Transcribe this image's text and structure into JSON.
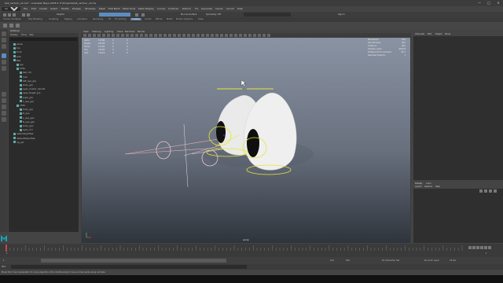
{
  "window": {
    "title": "ball_cartoon_v2.ma* - Autodesk Maya 2018.4: E:\\Projects\\ball_cartoon_v2.ma",
    "controls": [
      "—",
      "□",
      "✕"
    ]
  },
  "menubar": {
    "items": [
      "File",
      "Edit",
      "Create",
      "Select",
      "Modify",
      "Display",
      "Windows",
      "Mesh",
      "Edit Mesh",
      "Mesh Tools",
      "Mesh Display",
      "Curves",
      "Surfaces",
      "Deform",
      "UV",
      "Generate",
      "Cache",
      "Arnold",
      "Help"
    ]
  },
  "statusline": {
    "mode": "Animation",
    "objects_label": "Objects",
    "no_live_surface": "No Live Surface",
    "symmetry": "Symmetry: Off",
    "sign_in": "Sign In"
  },
  "shelf": {
    "tabs": [
      "Curves / Surfaces",
      "Poly Modeling",
      "Sculpting",
      "Rigging",
      "Animation",
      "Rendering",
      "FX",
      "FX Caching",
      "Custom",
      "Arnold",
      "Bifrost",
      "MASH",
      "Motion Graphics",
      "XGen"
    ],
    "active_index": 8
  },
  "outliner": {
    "title": "Outliner",
    "menu": [
      "Display",
      "Show",
      "Help"
    ],
    "items": [
      {
        "label": "persp",
        "depth": 1
      },
      {
        "label": "top",
        "depth": 1
      },
      {
        "label": "front",
        "depth": 1
      },
      {
        "label": "side",
        "depth": 1
      },
      {
        "label": "Ball",
        "depth": 1
      },
      {
        "label": "grp",
        "depth": 2
      },
      {
        "label": "CTRL",
        "depth": 2
      },
      {
        "label": "ball_ctrl",
        "depth": 3
      },
      {
        "label": "root",
        "depth": 3
      },
      {
        "label": "left_eye_grp",
        "depth": 3
      },
      {
        "label": "body_grp",
        "depth": 3
      },
      {
        "label": "eyes_cluster_handle",
        "depth": 3
      },
      {
        "label": "eyes_target_grp",
        "depth": 3
      },
      {
        "label": "pupil_grp",
        "depth": 3
      },
      {
        "label": "L_eye_grp",
        "depth": 3
      },
      {
        "label": "CTRL",
        "depth": 2
      },
      {
        "label": "body_grp",
        "depth": 3
      },
      {
        "label": "R_eye",
        "depth": 3
      },
      {
        "label": "L_eye_geo",
        "depth": 3
      },
      {
        "label": "R_eye_geo",
        "depth": 3
      },
      {
        "label": "body_geo",
        "depth": 3
      },
      {
        "label": "eyes_ctrl",
        "depth": 3
      },
      {
        "label": "defaultLightSet",
        "depth": 1
      },
      {
        "label": "defaultObjectSet",
        "depth": 1
      },
      {
        "label": "rig_set",
        "depth": 1
      }
    ]
  },
  "viewport": {
    "menu": [
      "View",
      "Shading",
      "Lighting",
      "Show",
      "Renderer",
      "Panels"
    ],
    "camera_label": "persp",
    "hud_left": {
      "rows": [
        [
          "Verts:",
          "11368",
          "0",
          "0"
        ],
        [
          "Edges:",
          "22528",
          "0",
          "0"
        ],
        [
          "Faces:",
          "11164",
          "0",
          "0"
        ],
        [
          "Tris:",
          "22400",
          "0",
          "0"
        ],
        [
          "UVs:",
          "11610",
          "0",
          "0"
        ]
      ]
    },
    "hud_right": {
      "rows": [
        [
          "Backfaces:",
          "N/A"
        ],
        [
          "Smoothness:",
          "N/A"
        ],
        [
          "Instance:",
          "N/A"
        ],
        [
          "Display Layer:",
          "default"
        ],
        [
          "Distance From Camera:",
          "26.7"
        ],
        [
          "Selected Objects:",
          "1"
        ]
      ]
    },
    "gradient_top": "#8a93a3",
    "gradient_bottom": "#2f343c",
    "egg_color": "#e8e8e8",
    "ctrl_color": "#e6e63a"
  },
  "channelbox": {
    "tabs": [
      "Channels",
      "Edit",
      "Object",
      "Show"
    ]
  },
  "layers": {
    "title": "Display",
    "tabs": [
      "Display",
      "Anim"
    ],
    "menu": [
      "Layers",
      "Options",
      "Help"
    ]
  },
  "timeline": {
    "start": "1",
    "end": "120",
    "current": "1",
    "range_end": "200",
    "fps": "24 fps",
    "no_character_set": "No Character Set",
    "no_anim_layer": "No Anim Layer"
  },
  "cmdline": {
    "label": "MEL"
  },
  "helpline": {
    "text": "Move Tool: Use manipulator to move object(s). Ctrl+middle-drag to move components along normals."
  }
}
